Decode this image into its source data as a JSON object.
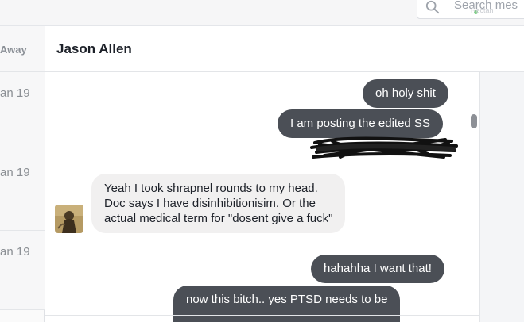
{
  "search": {
    "placeholder": "Search mes",
    "tag_text": "Rectan"
  },
  "left_header": {
    "label": "Away"
  },
  "conversations": [
    {
      "date": "an 19"
    },
    {
      "date": "an 19"
    },
    {
      "date": "an 19"
    }
  ],
  "chat": {
    "contact_name": "Jason Allen"
  },
  "messages": [
    {
      "direction": "outgoing",
      "text": "oh holy shit"
    },
    {
      "direction": "outgoing",
      "text": "I am posting the edited SS"
    },
    {
      "direction": "incoming",
      "lines": [
        "Yeah I took shrapnel rounds to my head.",
        "Doc says I have disinhibitionisim. Or the",
        "actual medical term for \"dosent give a fuck\""
      ]
    },
    {
      "direction": "outgoing",
      "text": "hahahha I want that!"
    },
    {
      "direction": "outgoing",
      "text": "now this bitch.. yes PTSD needs to be"
    }
  ],
  "colors": {
    "outgoing_bubble": "#4b4f56",
    "incoming_bubble": "#f1f0f0",
    "scribble": "#111111"
  }
}
